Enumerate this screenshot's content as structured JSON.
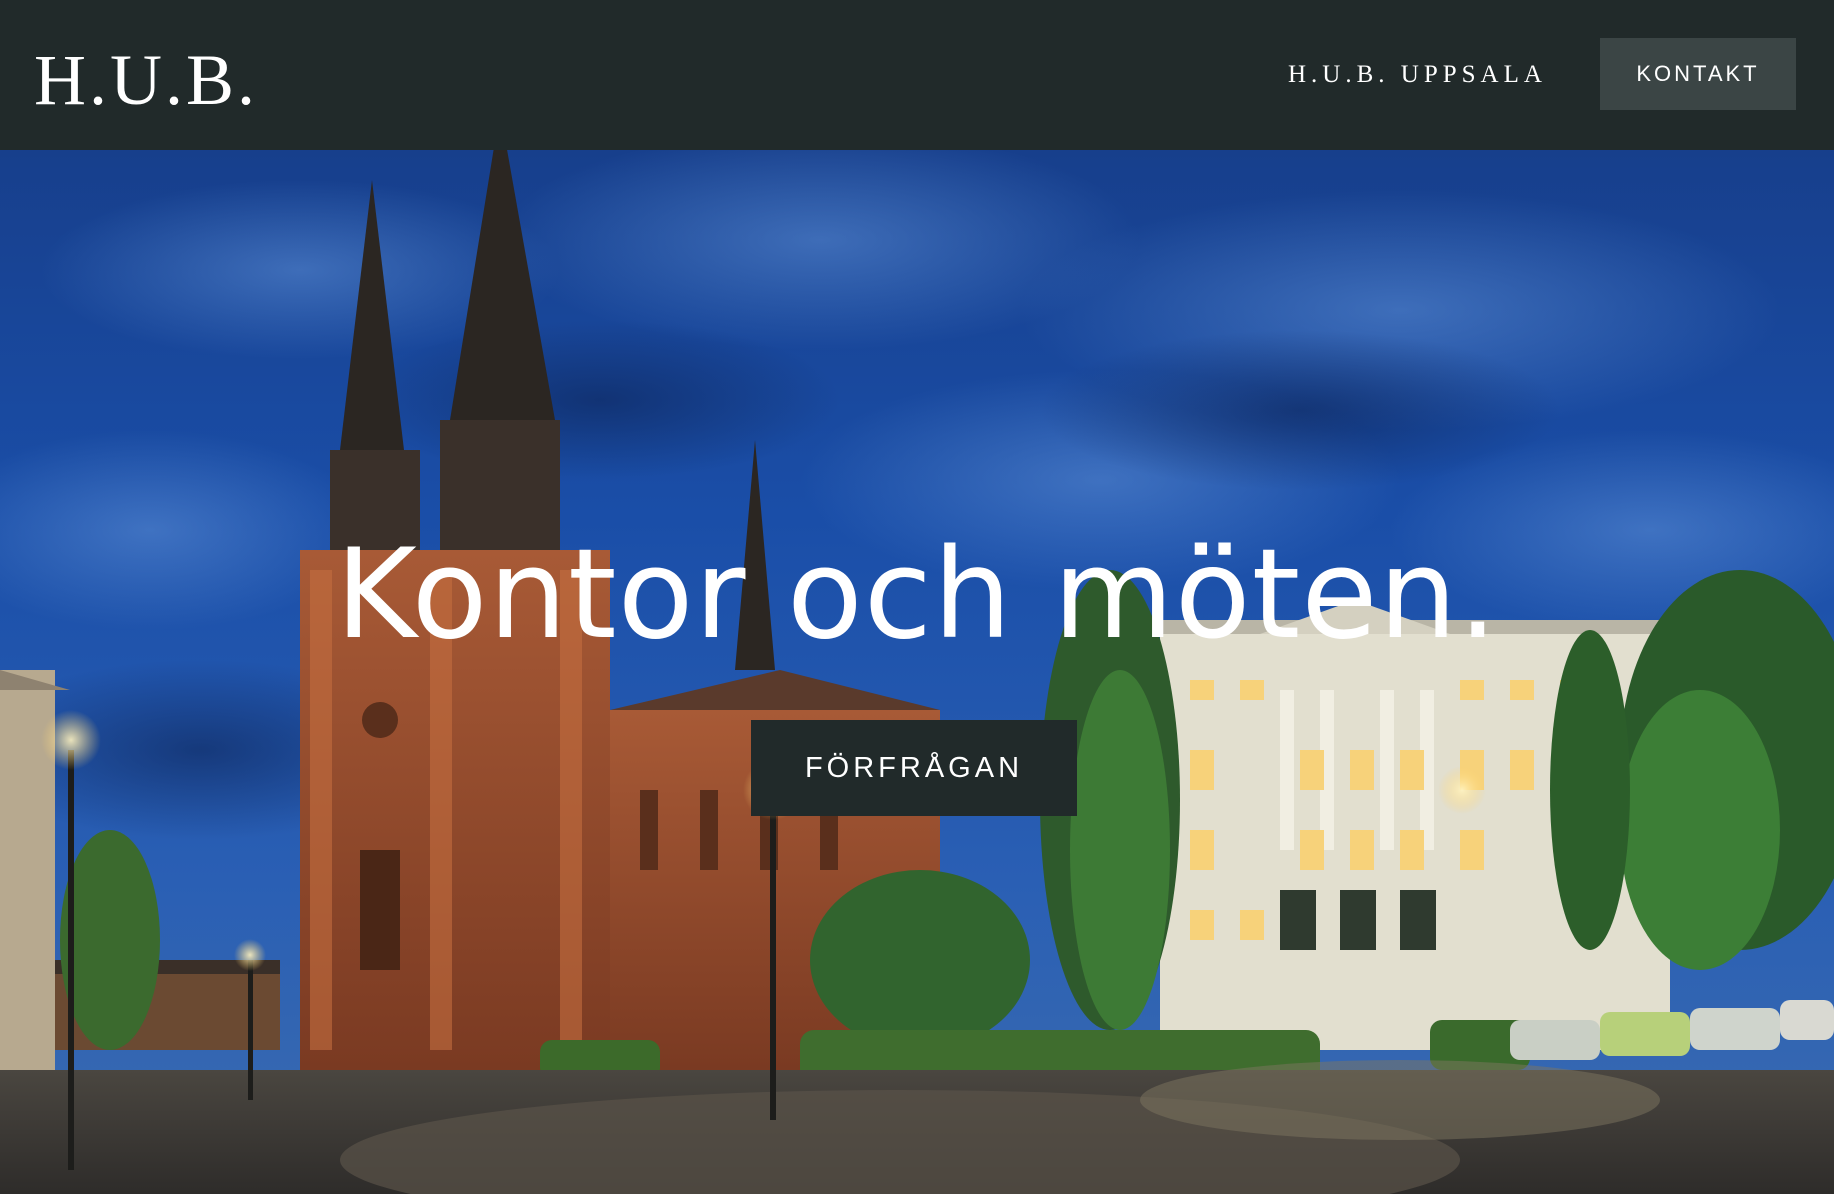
{
  "header": {
    "logo": "H.U.B.",
    "nav_link": "H.U.B. UPPSALA",
    "contact_button": "KONTAKT"
  },
  "hero": {
    "title": "Kontor och möten.",
    "request_button": "FÖRFRÅGAN",
    "image_description_icon": "cathedral-photo"
  },
  "colors": {
    "header_bg": "#212a2a",
    "contact_button_bg": "#3b4545",
    "request_button_bg": "#212a2a",
    "text": "#ffffff"
  }
}
